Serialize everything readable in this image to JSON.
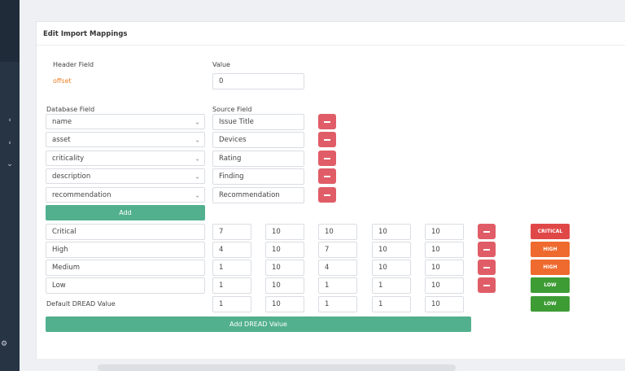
{
  "panel": {
    "title": "Edit Import Mappings"
  },
  "header_field": {
    "label": "Header Field",
    "value_label": "Value",
    "name": "offset",
    "value": "0"
  },
  "mappings": {
    "database_label": "Database Field",
    "source_label": "Source Field",
    "rows": [
      {
        "db": "name",
        "source": "Issue Title"
      },
      {
        "db": "asset",
        "source": "Devices"
      },
      {
        "db": "criticality",
        "source": "Rating"
      },
      {
        "db": "description",
        "source": "Finding"
      },
      {
        "db": "recommendation",
        "source": "Recommendation"
      }
    ],
    "add_label": "Add"
  },
  "dread": {
    "rows": [
      {
        "name": "Critical",
        "values": [
          "7",
          "10",
          "10",
          "10",
          "10"
        ],
        "badge": "CRITICAL",
        "badge_color": "#e04848"
      },
      {
        "name": "High",
        "values": [
          "4",
          "10",
          "7",
          "10",
          "10"
        ],
        "badge": "HIGH",
        "badge_color": "#ef6a2e"
      },
      {
        "name": "Medium",
        "values": [
          "1",
          "10",
          "4",
          "10",
          "10"
        ],
        "badge": "HIGH",
        "badge_color": "#ef6a2e"
      },
      {
        "name": "Low",
        "values": [
          "1",
          "10",
          "1",
          "1",
          "10"
        ],
        "badge": "LOW",
        "badge_color": "#3e9c35"
      }
    ],
    "default": {
      "label": "Default DREAD Value",
      "values": [
        "1",
        "10",
        "1",
        "1",
        "10"
      ],
      "badge": "LOW",
      "badge_color": "#3e9c35"
    },
    "add_label": "Add DREAD Value"
  },
  "icons": {
    "remove": "minus-icon",
    "dropdown": "chevron-down-icon",
    "sidebar": [
      "chevron-left-icon",
      "chevron-left-icon",
      "chevron-down-icon",
      "gear-icon"
    ]
  },
  "colors": {
    "accent": "#52b08e",
    "danger": "#e05d67",
    "sidebar": "#273444"
  }
}
